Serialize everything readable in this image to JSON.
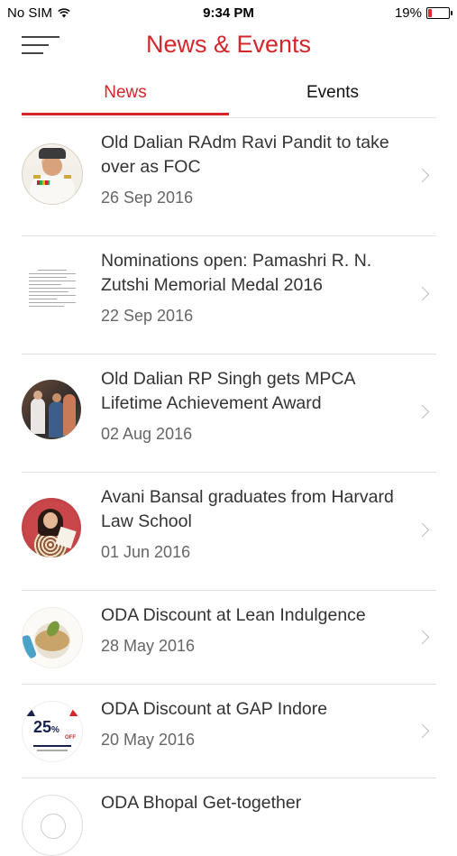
{
  "status_bar": {
    "carrier": "No SIM",
    "time": "9:34 PM",
    "battery": "19%",
    "battery_level": 0.19
  },
  "header": {
    "title": "News & Events"
  },
  "tabs": [
    {
      "label": "News",
      "active": true
    },
    {
      "label": "Events",
      "active": false
    }
  ],
  "news": [
    {
      "headline": "Old Dalian RAdm Ravi Pandit to take over as FOC",
      "date": "26 Sep 2016"
    },
    {
      "headline": "Nominations open: Pamashri R. N. Zutshi Memorial Medal 2016",
      "date": "22 Sep 2016"
    },
    {
      "headline": "Old Dalian RP Singh gets MPCA Lifetime Achievement Award",
      "date": "02 Aug 2016"
    },
    {
      "headline": "Avani Bansal graduates from Harvard Law School",
      "date": "01 Jun 2016"
    },
    {
      "headline": "ODA Discount at Lean Indulgence",
      "date": "28 May 2016"
    },
    {
      "headline": "ODA Discount at GAP Indore",
      "date": "20 May 2016"
    },
    {
      "headline": "ODA Bhopal Get-together",
      "date": ""
    }
  ],
  "thumb_text": {
    "gap_percent": "25",
    "gap_percent_sign": "%",
    "gap_off": "OFF"
  },
  "colors": {
    "accent": "#d5262b",
    "text": "#333333",
    "subtext": "#666666",
    "divider": "#e1e1e1"
  }
}
